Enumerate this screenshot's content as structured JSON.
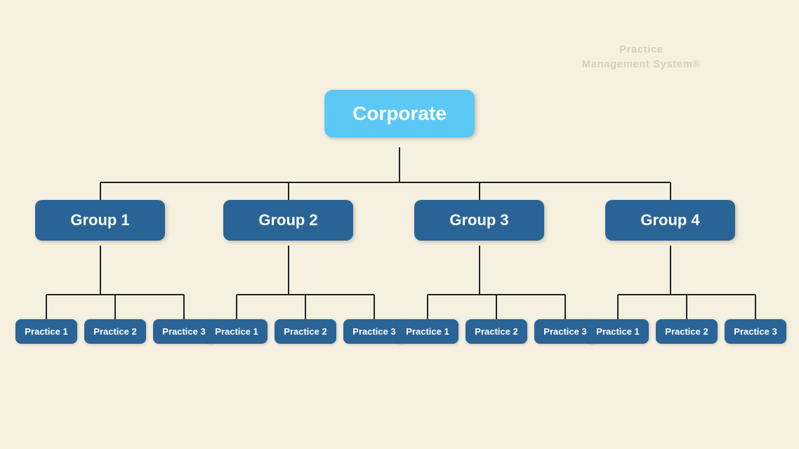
{
  "watermark": {
    "line1": "Practice",
    "line2": "Management System®"
  },
  "corporate": {
    "label": "Corporate"
  },
  "groups": [
    {
      "id": "group1",
      "label": "Group 1"
    },
    {
      "id": "group2",
      "label": "Group 2"
    },
    {
      "id": "group3",
      "label": "Group 3"
    },
    {
      "id": "group4",
      "label": "Group 4"
    }
  ],
  "practices": [
    {
      "id": "g1-p1",
      "label": "Practice 1"
    },
    {
      "id": "g1-p2",
      "label": "Practice 2"
    },
    {
      "id": "g1-p3",
      "label": "Practice 3"
    },
    {
      "id": "g2-p1",
      "label": "Practice 1"
    },
    {
      "id": "g2-p2",
      "label": "Practice 2"
    },
    {
      "id": "g2-p3",
      "label": "Practice 3"
    },
    {
      "id": "g3-p1",
      "label": "Practice 1"
    },
    {
      "id": "g3-p2",
      "label": "Practice 2"
    },
    {
      "id": "g3-p3",
      "label": "Practice 3"
    },
    {
      "id": "g4-p1",
      "label": "Practice 1"
    },
    {
      "id": "g4-p2",
      "label": "Practice 2"
    },
    {
      "id": "g4-p3",
      "label": "Practice 3"
    }
  ],
  "colors": {
    "background": "#f5f0e0",
    "corporate": "#5bc8f5",
    "group": "#2a6496",
    "practice": "#2a6496",
    "connector": "#222222"
  }
}
